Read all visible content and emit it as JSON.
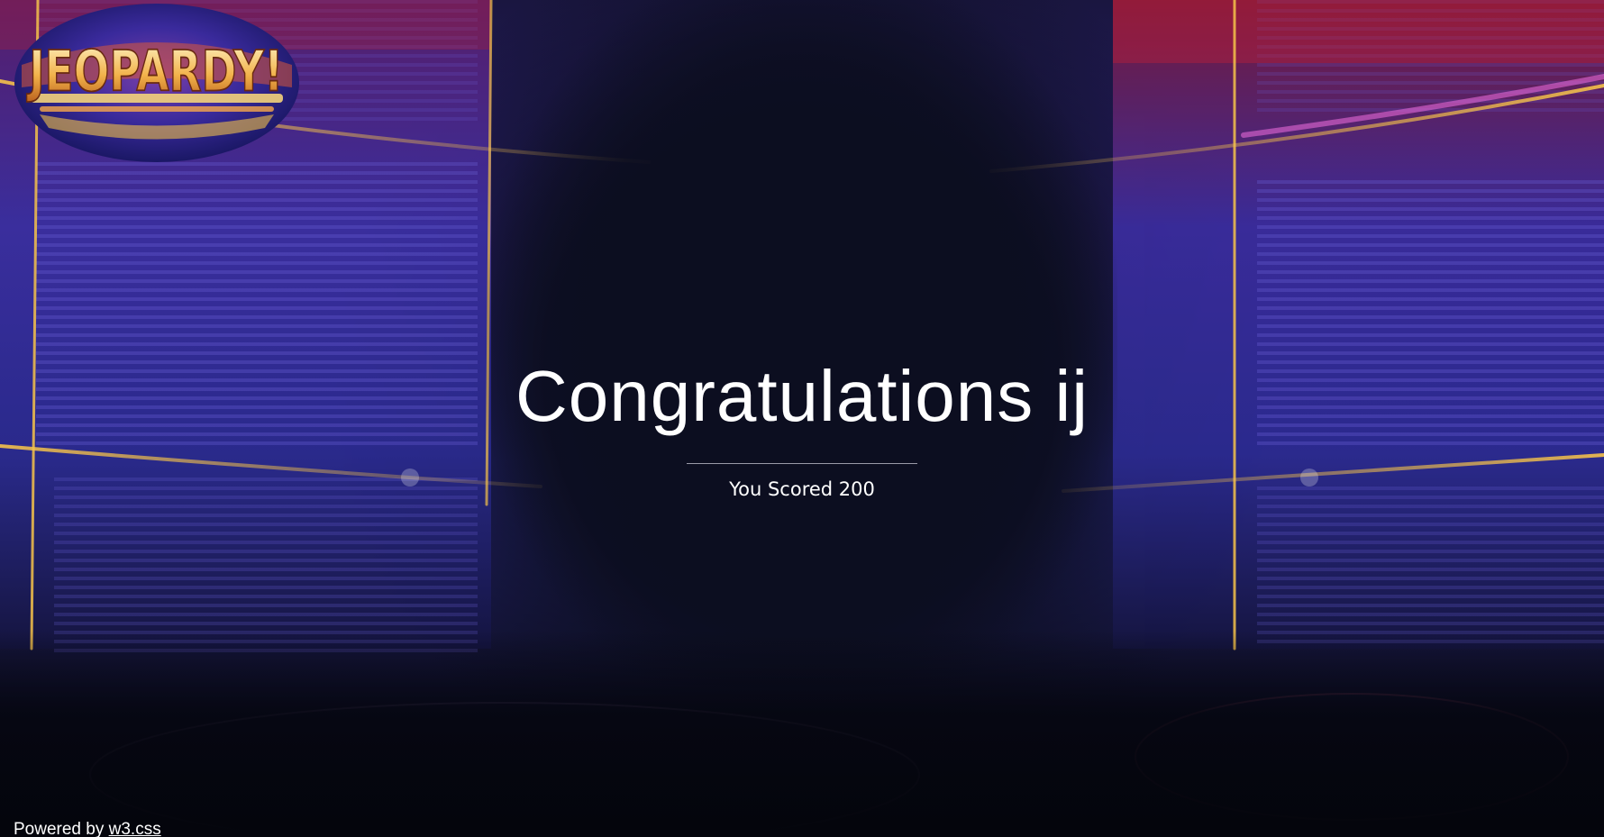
{
  "logo": {
    "text": "JEOPARDY!"
  },
  "result": {
    "heading": "Congratulations ij",
    "score_text": "You Scored 200"
  },
  "footer": {
    "prefix": "Powered by ",
    "link_text": "w3.css"
  },
  "colors": {
    "background": "#0c0f20",
    "frame_gold": "#f2c14e",
    "panel_blue": "#3a36a8",
    "accent_red": "#c0203a",
    "accent_magenta": "#d24ad8"
  }
}
